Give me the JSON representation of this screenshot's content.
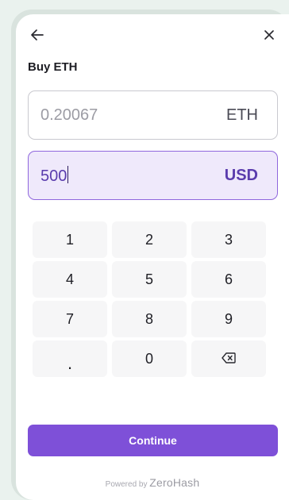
{
  "header": {
    "title": "Buy ETH",
    "back_icon": "arrow-left-icon",
    "close_icon": "close-icon"
  },
  "crypto_field": {
    "value": "0.20067",
    "currency": "ETH"
  },
  "fiat_field": {
    "value": "500",
    "currency": "USD"
  },
  "keypad": {
    "keys": [
      "1",
      "2",
      "3",
      "4",
      "5",
      "6",
      "7",
      "8",
      "9",
      ".",
      "0"
    ],
    "backspace_icon": "backspace-icon"
  },
  "continue_label": "Continue",
  "footer": {
    "powered_by": "Powered by",
    "brand": "ZeroHash"
  },
  "colors": {
    "accent": "#7e50d8",
    "fiat_bg": "#efe9fb",
    "fiat_border": "#8f67dd"
  }
}
